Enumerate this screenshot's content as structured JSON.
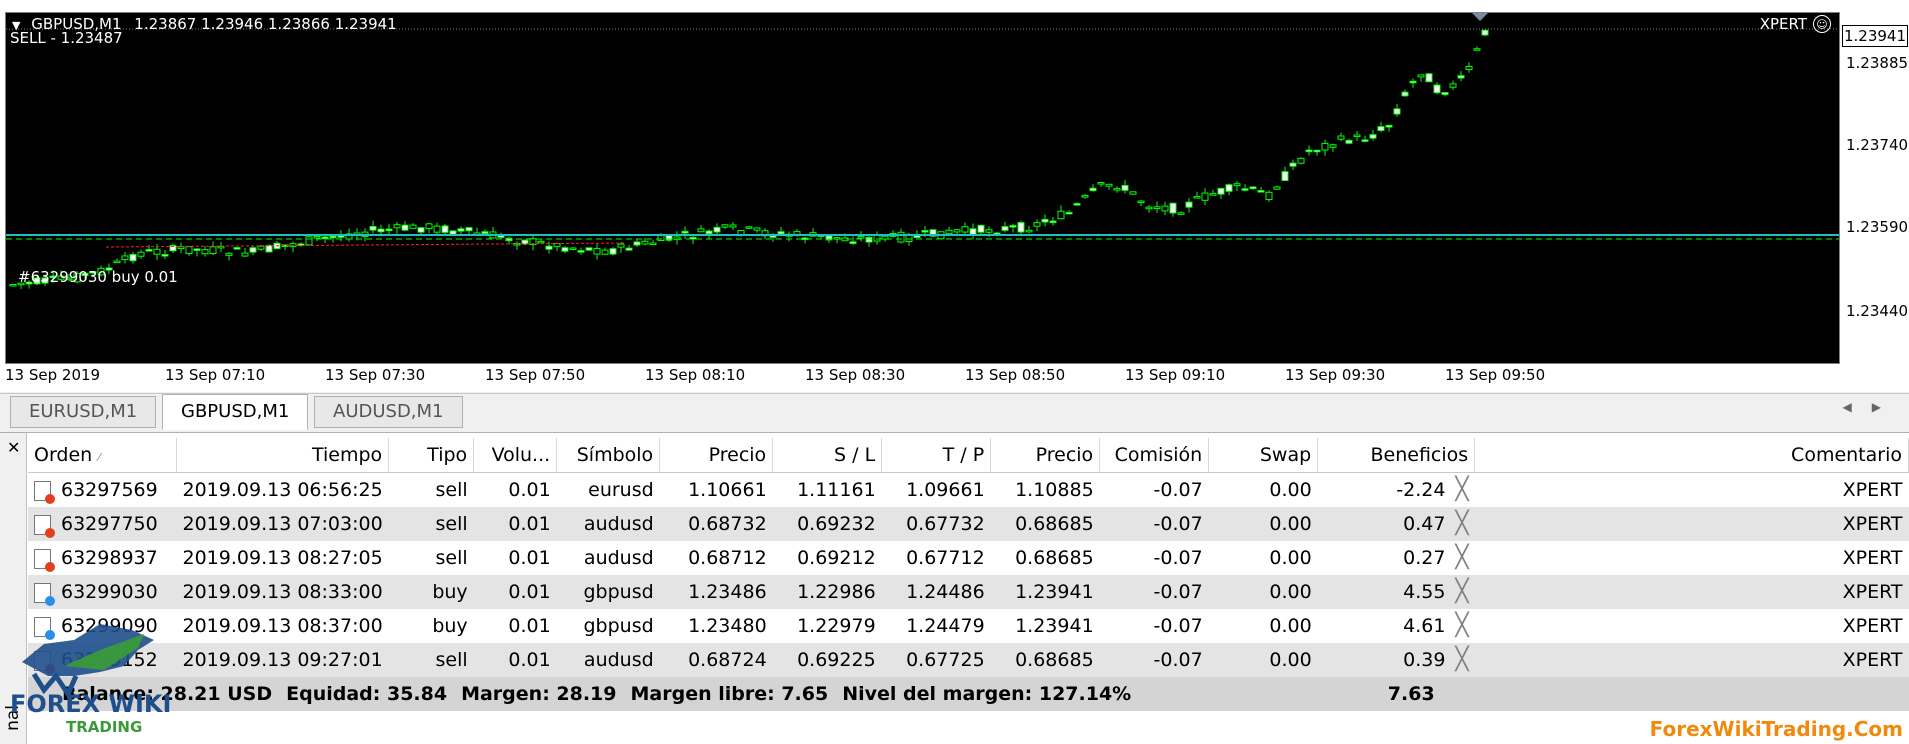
{
  "chart": {
    "title": "GBPUSD,M1",
    "ohlc": "1.23867 1.23946 1.23866 1.23941",
    "signal": "SELL - 1.23487",
    "ea_name": "XPERT",
    "order_line_label": "#63299030 buy 0.01",
    "current_price": "1.23941",
    "price_ticks": [
      "1.23885",
      "1.23740",
      "1.23590",
      "1.23440"
    ],
    "time_ticks": [
      "13 Sep 2019",
      "13 Sep 07:10",
      "13 Sep 07:30",
      "13 Sep 07:50",
      "13 Sep 08:10",
      "13 Sep 08:30",
      "13 Sep 08:50",
      "13 Sep 09:10",
      "13 Sep 09:30",
      "13 Sep 09:50"
    ],
    "colors": {
      "background": "#000000",
      "candle": "#00ff00",
      "order_line": "#20c0c0",
      "sl_line": "#ff2020"
    }
  },
  "tabs": [
    {
      "label": "EURUSD,M1",
      "active": false
    },
    {
      "label": "GBPUSD,M1",
      "active": true
    },
    {
      "label": "AUDUSD,M1",
      "active": false
    }
  ],
  "terminal": {
    "side_label": "nal",
    "columns": [
      "Orden",
      "Tiempo",
      "Tipo",
      "Volu...",
      "Símbolo",
      "Precio",
      "S / L",
      "T / P",
      "Precio",
      "Comisión",
      "Swap",
      "Beneficios",
      "Comentario"
    ],
    "rows": [
      {
        "order": "63297569",
        "time": "2019.09.13 06:56:25",
        "type": "sell",
        "volume": "0.01",
        "symbol": "eurusd",
        "price": "1.10661",
        "sl": "1.11161",
        "tp": "1.09661",
        "price_now": "1.10885",
        "commission": "-0.07",
        "swap": "0.00",
        "profit": "-2.24",
        "comment": "XPERT"
      },
      {
        "order": "63297750",
        "time": "2019.09.13 07:03:00",
        "type": "sell",
        "volume": "0.01",
        "symbol": "audusd",
        "price": "0.68732",
        "sl": "0.69232",
        "tp": "0.67732",
        "price_now": "0.68685",
        "commission": "-0.07",
        "swap": "0.00",
        "profit": "0.47",
        "comment": "XPERT"
      },
      {
        "order": "63298937",
        "time": "2019.09.13 08:27:05",
        "type": "sell",
        "volume": "0.01",
        "symbol": "audusd",
        "price": "0.68712",
        "sl": "0.69212",
        "tp": "0.67712",
        "price_now": "0.68685",
        "commission": "-0.07",
        "swap": "0.00",
        "profit": "0.27",
        "comment": "XPERT"
      },
      {
        "order": "63299030",
        "time": "2019.09.13 08:33:00",
        "type": "buy",
        "volume": "0.01",
        "symbol": "gbpusd",
        "price": "1.23486",
        "sl": "1.22986",
        "tp": "1.24486",
        "price_now": "1.23941",
        "commission": "-0.07",
        "swap": "0.00",
        "profit": "4.55",
        "comment": "XPERT"
      },
      {
        "order": "63299090",
        "time": "2019.09.13 08:37:00",
        "type": "buy",
        "volume": "0.01",
        "symbol": "gbpusd",
        "price": "1.23480",
        "sl": "1.22979",
        "tp": "1.24479",
        "price_now": "1.23941",
        "commission": "-0.07",
        "swap": "0.00",
        "profit": "4.61",
        "comment": "XPERT"
      },
      {
        "order": "63299152",
        "time": "2019.09.13 09:27:01",
        "type": "sell",
        "volume": "0.01",
        "symbol": "audusd",
        "price": "0.68724",
        "sl": "0.69225",
        "tp": "0.67725",
        "price_now": "0.68685",
        "commission": "-0.07",
        "swap": "0.00",
        "profit": "0.39",
        "comment": "XPERT"
      }
    ],
    "summary": {
      "balance": "Balance: 28.21 USD",
      "equity": "Equidad: 35.84",
      "margin": "Margen: 28.19",
      "free_margin": "Margen libre: 7.65",
      "margin_level": "Nivel del margen: 127.14%",
      "total_profit": "7.63"
    }
  },
  "logo": {
    "line1": "FOREX WIKI",
    "line2": "TRADING",
    "colors": {
      "blue": "#1f4e8c",
      "green": "#3a9a3a"
    }
  },
  "watermark": "ForexWikiTrading.Com",
  "icons": {
    "sell": "order-sell-icon",
    "buy": "order-buy-icon",
    "close": "close-x-icon"
  }
}
